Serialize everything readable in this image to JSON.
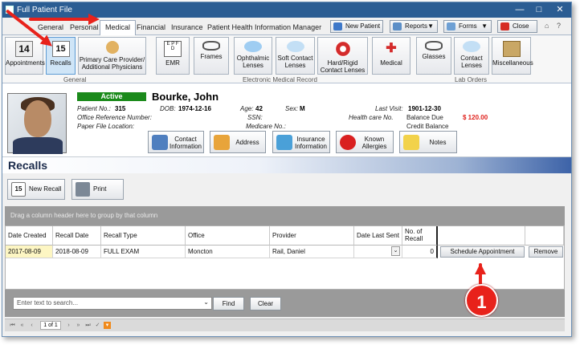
{
  "window": {
    "title": "Full Patient File",
    "controls": {
      "minimize": "—",
      "maximize": "□",
      "close": "✕"
    }
  },
  "tabs": [
    {
      "label": "General"
    },
    {
      "label": "Personal"
    },
    {
      "label": "Medical"
    },
    {
      "label": "Financial"
    },
    {
      "label": "Insurance"
    },
    {
      "label": "Patient Health Information Manager"
    }
  ],
  "topbar": {
    "new_patient": "New Patient",
    "reports": "Reports",
    "forms": "Forms",
    "close": "Close"
  },
  "ribbon": {
    "general_label": "General",
    "emr_label": "Electronic Medical Record",
    "lab_label": "Lab Orders",
    "general": [
      {
        "label": "Appointments"
      },
      {
        "label": "Recalls"
      },
      {
        "label": "Primary Care Provider/ Additional Physicians"
      }
    ],
    "emr": [
      {
        "label": "EMR"
      },
      {
        "label": "Frames"
      },
      {
        "label": "Ophthalmic Lenses"
      },
      {
        "label": "Soft Contact Lenses"
      },
      {
        "label": "Hard/Rigid Contact Lenses"
      },
      {
        "label": "Medical"
      }
    ],
    "lab": [
      {
        "label": "Glasses"
      },
      {
        "label": "Contact Lenses"
      },
      {
        "label": "Miscellaneous"
      }
    ]
  },
  "patient": {
    "status": "Active",
    "name": "Bourke, John",
    "patient_no_label": "Patient No.:",
    "patient_no": "315",
    "dob_label": "DOB:",
    "dob": "1974-12-16",
    "age_label": "Age:",
    "age": "42",
    "sex_label": "Sex:",
    "sex": "M",
    "last_visit_label": "Last Visit:",
    "last_visit": "1901-12-30",
    "office_ref_label": "Office Reference Number:",
    "ssn_label": "SSN:",
    "health_care_label": "Health care No.",
    "balance_due_label": "Balance Due",
    "balance_due": "$ 120.00",
    "credit_balance_label": "Credit Balance",
    "paper_file_label": "Paper File Location:",
    "medicare_label": "Medicare No.:"
  },
  "quick_buttons": [
    {
      "label": "Contact Information"
    },
    {
      "label": "Address"
    },
    {
      "label": "Insurance Information"
    },
    {
      "label": "Known Allergies"
    },
    {
      "label": "Notes"
    }
  ],
  "section": {
    "title": "Recalls",
    "new_recall": "New Recall",
    "print": "Print"
  },
  "grid": {
    "group_hint": "Drag a column header here to group by that column",
    "columns": [
      "Date Created",
      "Recall Date",
      "Recall Type",
      "Office",
      "Provider",
      "Date Last Sent",
      "No. of Recall",
      "",
      ""
    ],
    "rows": [
      {
        "date_created": "2017-08-09",
        "recall_date": "2018-08-09",
        "recall_type": "FULL EXAM",
        "office": "Moncton",
        "provider": "Rail, Daniel",
        "date_last_sent": "",
        "no_of_recall": "0",
        "schedule": "Schedule Appointment",
        "remove": "Remove"
      }
    ]
  },
  "search": {
    "placeholder": "Enter text to search...",
    "find": "Find",
    "clear": "Clear"
  },
  "pager": {
    "page_text": "1 of 1"
  },
  "annotation": {
    "number": "1"
  },
  "colors": {
    "titlebar": "#2b5d93",
    "active_badge": "#1b8a1b",
    "balance": "#e0201b",
    "arrow": "#e8221b"
  }
}
